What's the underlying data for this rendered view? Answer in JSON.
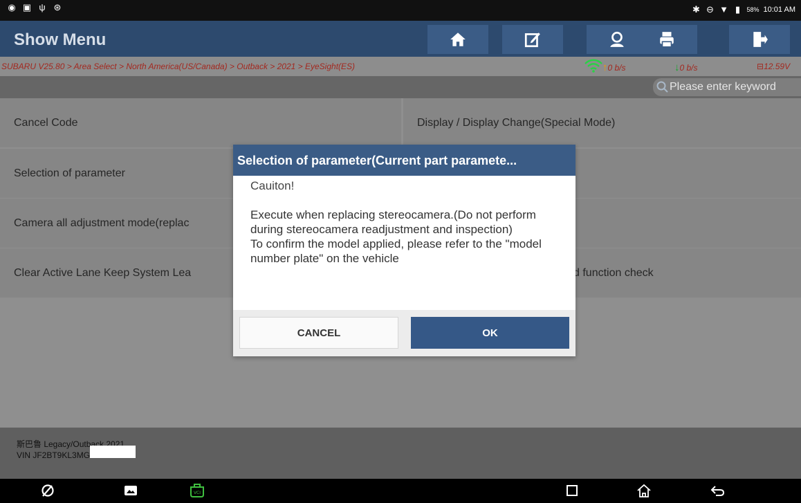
{
  "status_bar": {
    "battery": "58%",
    "time": "10:01 AM"
  },
  "header": {
    "title": "Show Menu",
    "buttons": [
      "home-icon",
      "edit-report-icon",
      "user-icon",
      "print-icon",
      "exit-icon"
    ]
  },
  "crumb_bar": {
    "breadcrumb": "SUBARU V25.80 > Area Select > North America(US/Canada) > Outback > 2021 > EyeSight(ES)",
    "upload": "0 b/s",
    "download": "0 b/s",
    "voltage": "12.59V"
  },
  "search": {
    "placeholder": "Please enter keyword"
  },
  "menu": {
    "items": [
      "Cancel Code",
      "Display / Display Change(Special Mode)",
      "Selection of parameter",
      "",
      "Camera all adjustment mode(replac",
      "",
      "Clear Active Lane Keep System Lea",
      "d function check"
    ]
  },
  "footer": {
    "vehicle": "斯巴鲁 Legacy/Outback 2021",
    "vin": "VIN JF2BT9KL3MG"
  },
  "dialog": {
    "title": "Selection of parameter(Current part paramete...",
    "caution": "Cauiton!",
    "line1": "Execute when replacing stereocamera.(Do not perform during stereocamera readjustment and inspection)",
    "line2": "To confirm the model applied, please refer to the \"model number plate\" on the vehicle",
    "cancel_label": "CANCEL",
    "ok_label": "OK"
  },
  "colors": {
    "header_bg": "#2d4a6e",
    "button_bg": "#3b5c86",
    "breadcrumb_text": "#a3281f",
    "ok_button": "#355887"
  }
}
